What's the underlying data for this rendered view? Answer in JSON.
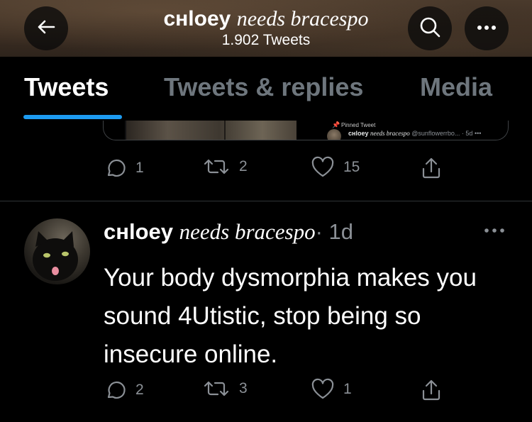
{
  "header": {
    "name_bold": "cʜloey",
    "name_italic": "needs bracespo",
    "tweet_count": "1.902 Tweets"
  },
  "tabs": [
    {
      "label": "Tweets",
      "active": true
    },
    {
      "label": "Tweets & replies",
      "active": false
    },
    {
      "label": "Media",
      "active": false
    }
  ],
  "pinned_card": {
    "pinned_label": "Pinned Tweet",
    "name_bold": "cʜloey",
    "name_italic": "needs bracespo",
    "handle": "@sunflowerrbo...",
    "time": "· 5d"
  },
  "pinned_actions": {
    "replies": "1",
    "retweets": "2",
    "likes": "15"
  },
  "tweet": {
    "name_bold": "cʜloey",
    "name_italic": "needs bracespo",
    "time": "· 1d",
    "text": "Your body dysmorphia makes you sound 4Utistic, stop being so insecure online.",
    "replies": "2",
    "retweets": "3",
    "likes": "1"
  },
  "colors": {
    "accent": "#1d9bf0",
    "muted": "#8b9096",
    "background": "#000000"
  },
  "icons": [
    "back-arrow-icon",
    "search-icon",
    "more-icon",
    "pin-icon",
    "reply-icon",
    "retweet-icon",
    "like-icon",
    "share-icon"
  ]
}
